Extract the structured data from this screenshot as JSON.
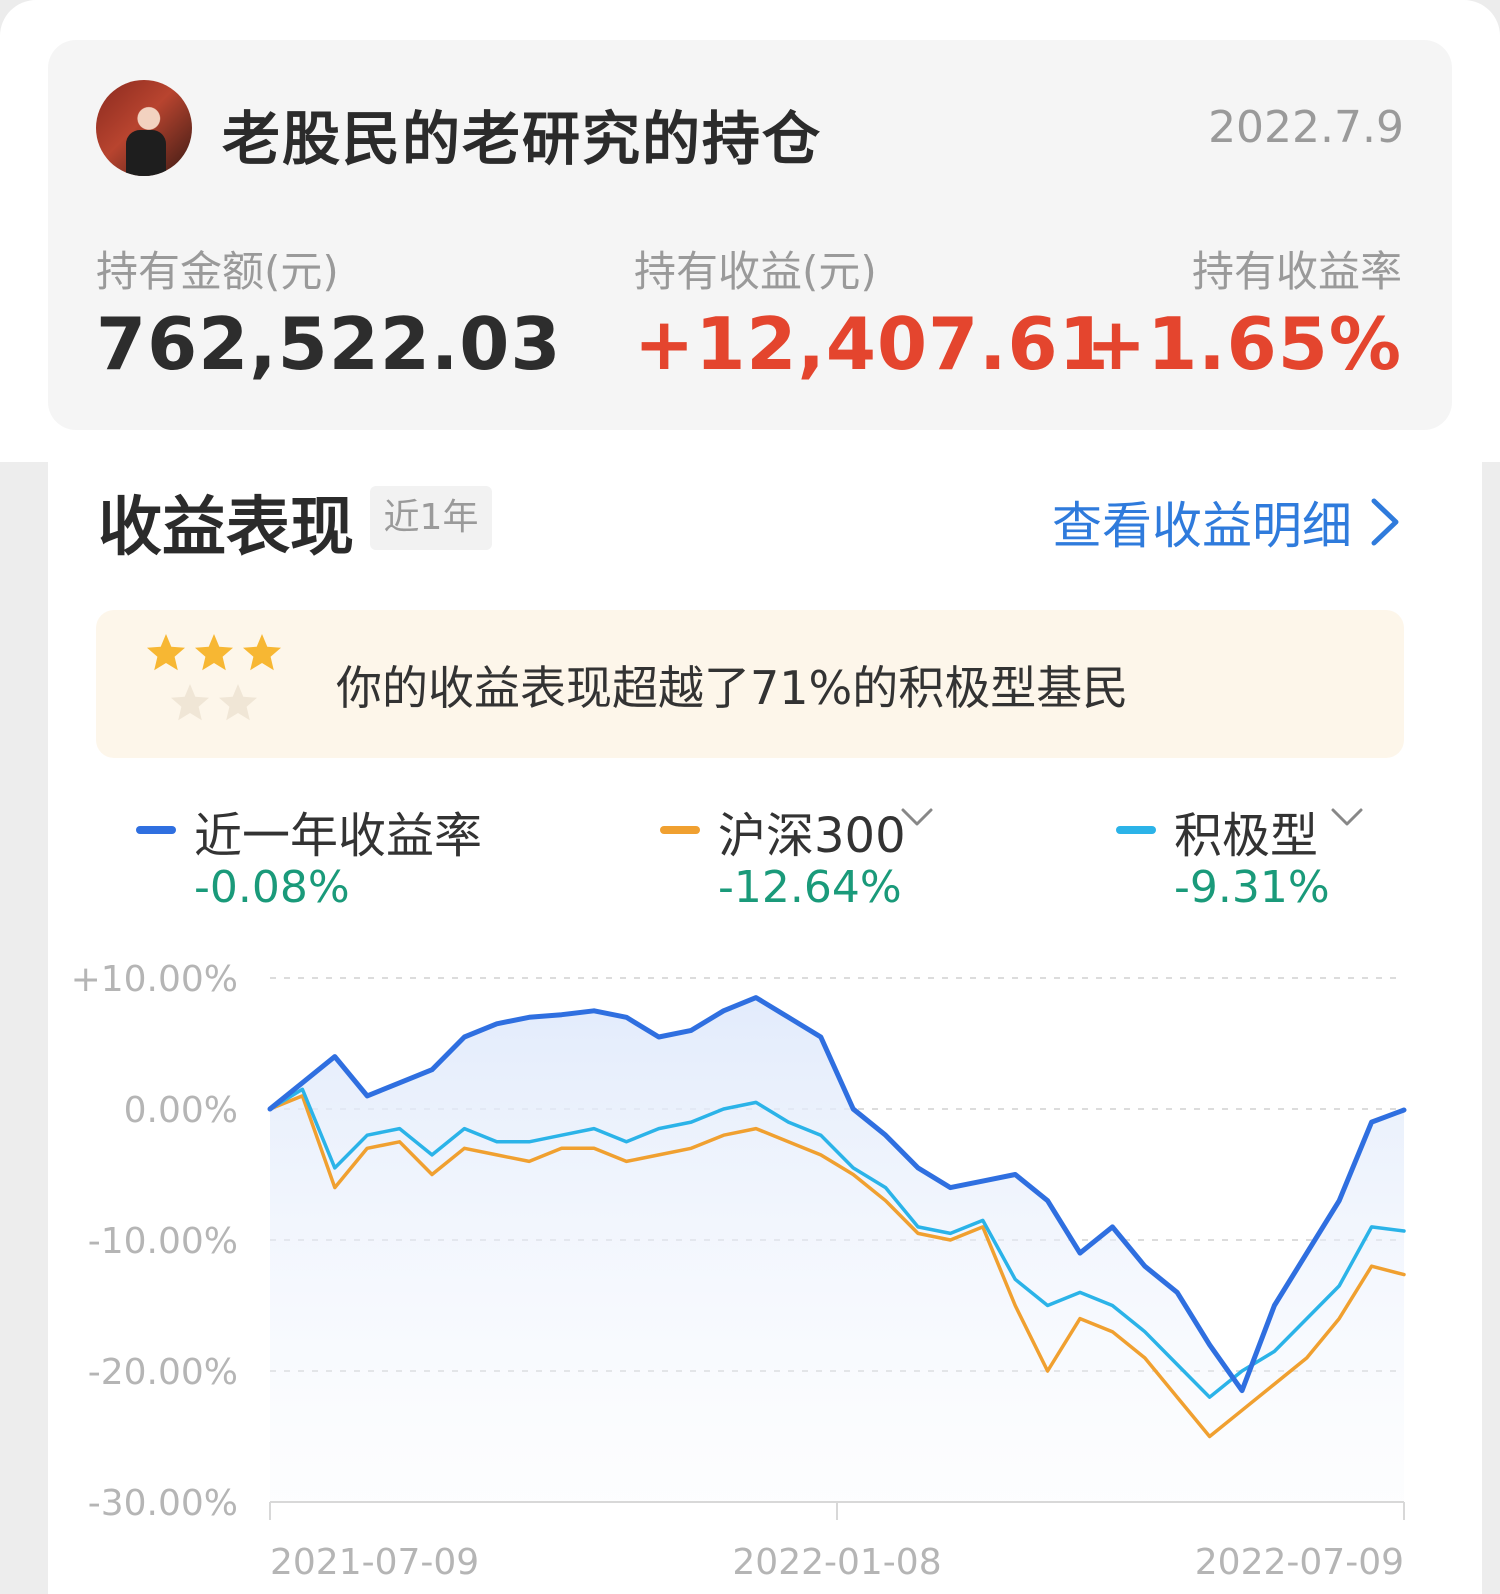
{
  "header": {
    "title": "老股民的老研究的持仓",
    "date": "2022.7.9"
  },
  "metrics": [
    {
      "label": "持有金额(元)",
      "value": "762,522.03"
    },
    {
      "label": "持有收益(元)",
      "value": "+12,407.61"
    },
    {
      "label": "持有收益率",
      "value": "+1.65%"
    }
  ],
  "section": {
    "title": "收益表现",
    "range_tag": "近1年",
    "details_link": "查看收益明细"
  },
  "rank": {
    "text": "你的收益表现超越了71%的积极型基民",
    "stars": 3.5,
    "stars_max": 5
  },
  "legend": [
    {
      "name": "近一年收益率",
      "value": "-0.08%",
      "color": "#2f6fe0"
    },
    {
      "name": "沪深300",
      "value": "-12.64%",
      "color": "#f0a030"
    },
    {
      "name": "积极型",
      "value": "-9.31%",
      "color": "#2bb3e8"
    }
  ],
  "colors": {
    "positive": "#e4452e",
    "negative": "#1a9a7a",
    "link": "#2f7bdc"
  },
  "chart_data": {
    "type": "line",
    "y_ticks": [
      "+10.00%",
      "0.00%",
      "-10.00%",
      "-20.00%",
      "-30.00%"
    ],
    "x_ticks": [
      "2021-07-09",
      "2022-01-08",
      "2022-07-09"
    ],
    "ylim": [
      -30,
      10
    ],
    "x": [
      "2021-07-09",
      "2021-07-20",
      "2021-07-30",
      "2021-08-10",
      "2021-08-20",
      "2021-08-31",
      "2021-09-10",
      "2021-09-21",
      "2021-10-01",
      "2021-10-12",
      "2021-10-22",
      "2021-11-02",
      "2021-11-12",
      "2021-11-23",
      "2021-12-03",
      "2021-12-14",
      "2021-12-24",
      "2022-01-04",
      "2022-01-14",
      "2022-01-25",
      "2022-02-04",
      "2022-02-15",
      "2022-02-25",
      "2022-03-08",
      "2022-03-18",
      "2022-03-29",
      "2022-04-08",
      "2022-04-19",
      "2022-04-29",
      "2022-05-10",
      "2022-05-20",
      "2022-05-31",
      "2022-06-10",
      "2022-06-21",
      "2022-07-01",
      "2022-07-09"
    ],
    "series": [
      {
        "name": "近一年收益率",
        "color": "#2f6fe0",
        "values": [
          0.0,
          2.0,
          4.0,
          1.0,
          2.0,
          3.0,
          5.5,
          6.5,
          7.0,
          7.2,
          7.5,
          7.0,
          5.5,
          6.0,
          7.5,
          8.5,
          7.0,
          5.5,
          0.0,
          -2.0,
          -4.5,
          -6.0,
          -5.5,
          -5.0,
          -7.0,
          -11.0,
          -9.0,
          -12.0,
          -14.0,
          -18.0,
          -21.5,
          -15.0,
          -11.0,
          -7.0,
          -1.0,
          -0.08
        ]
      },
      {
        "name": "沪深300",
        "color": "#f0a030",
        "values": [
          0.0,
          1.0,
          -6.0,
          -3.0,
          -2.5,
          -5.0,
          -3.0,
          -3.5,
          -4.0,
          -3.0,
          -3.0,
          -4.0,
          -3.5,
          -3.0,
          -2.0,
          -1.5,
          -2.5,
          -3.5,
          -5.0,
          -7.0,
          -9.5,
          -10.0,
          -9.0,
          -15.0,
          -20.0,
          -16.0,
          -17.0,
          -19.0,
          -22.0,
          -25.0,
          -23.0,
          -21.0,
          -19.0,
          -16.0,
          -12.0,
          -12.64
        ]
      },
      {
        "name": "积极型",
        "color": "#2bb3e8",
        "values": [
          0.0,
          1.5,
          -4.5,
          -2.0,
          -1.5,
          -3.5,
          -1.5,
          -2.5,
          -2.5,
          -2.0,
          -1.5,
          -2.5,
          -1.5,
          -1.0,
          0.0,
          0.5,
          -1.0,
          -2.0,
          -4.5,
          -6.0,
          -9.0,
          -9.5,
          -8.5,
          -13.0,
          -15.0,
          -14.0,
          -15.0,
          -17.0,
          -19.5,
          -22.0,
          -20.0,
          -18.5,
          -16.0,
          -13.5,
          -9.0,
          -9.31
        ]
      }
    ]
  }
}
